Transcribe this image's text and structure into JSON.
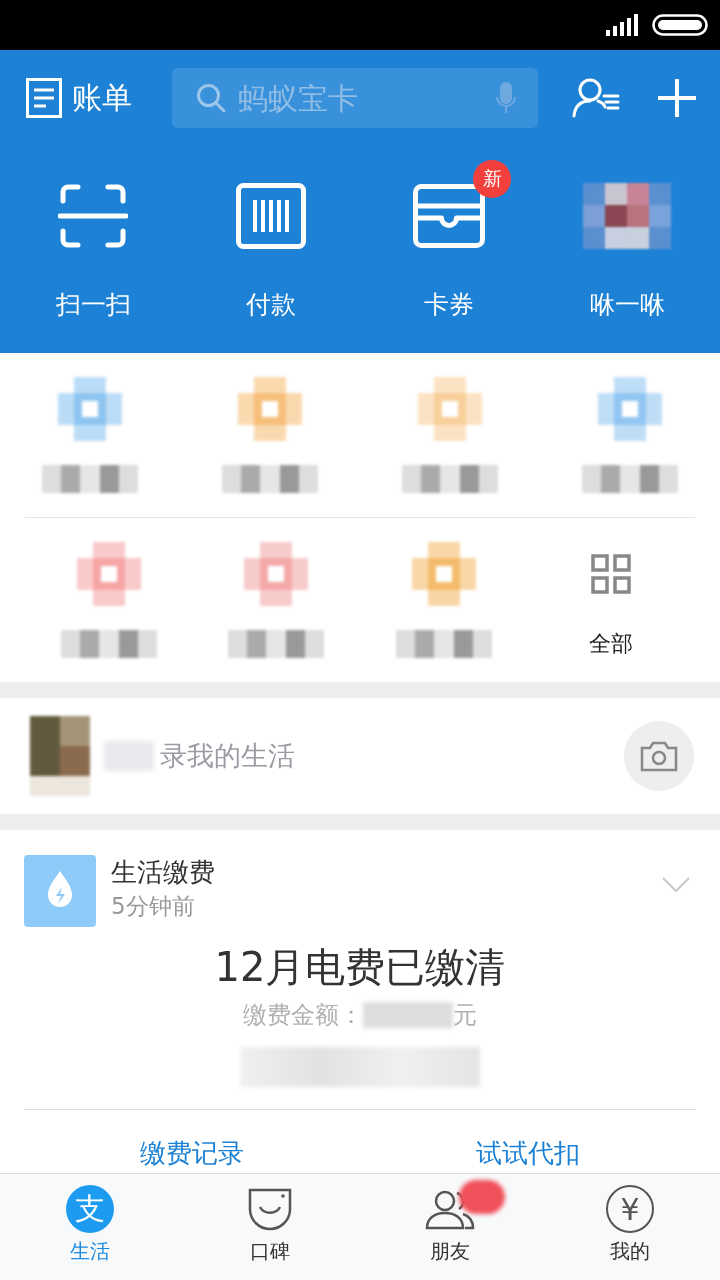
{
  "header": {
    "bill": "账单",
    "search": {
      "placeholder": "蚂蚁宝卡"
    }
  },
  "quick_actions": [
    {
      "label": "扫一扫",
      "kind": "scan"
    },
    {
      "label": "付款",
      "kind": "pay"
    },
    {
      "label": "卡券",
      "kind": "cards",
      "badge": "新"
    },
    {
      "label": "咻一咻",
      "kind": "blurred"
    }
  ],
  "apps": [
    {
      "kind": "blurred",
      "color": "#8ec5f0"
    },
    {
      "kind": "blurred",
      "color": "#f6bf7a"
    },
    {
      "kind": "blurred",
      "color": "#f8cf9a"
    },
    {
      "kind": "blurred",
      "color": "#92c6f2"
    },
    {
      "kind": "blurred",
      "color": "#f6a6a6"
    },
    {
      "kind": "blurred",
      "color": "#f4a9a9"
    },
    {
      "kind": "blurred",
      "color": "#f5bb6c"
    },
    {
      "kind": "all",
      "label": "全部"
    }
  ],
  "moments": {
    "prompt": "录我的生活"
  },
  "bill_card": {
    "title": "生活缴费",
    "time": "5分钟前",
    "headline": "12月电费已缴清",
    "amount_label": "缴费金额：",
    "amount_unit": "元",
    "actions": [
      "缴费记录",
      "试试代扣"
    ]
  },
  "tab_bar": [
    {
      "label": "生活",
      "kind": "life",
      "glyph": "支",
      "selected": true,
      "badge": false
    },
    {
      "label": "口碑",
      "kind": "koubei",
      "selected": false,
      "badge": false
    },
    {
      "label": "朋友",
      "kind": "friends",
      "selected": false,
      "badge": true
    },
    {
      "label": "我的",
      "kind": "mine",
      "glyph": "¥",
      "selected": false,
      "badge": false
    }
  ]
}
